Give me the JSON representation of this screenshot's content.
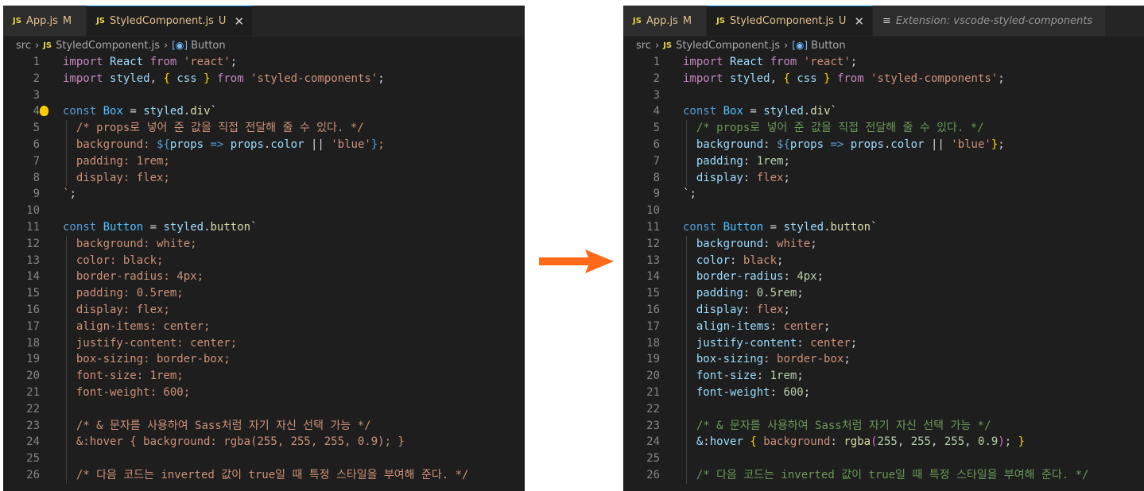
{
  "colors": {
    "editor_bg": "#1e1e1e",
    "tabbar_bg": "#252526",
    "arrow": "#ff6a1a",
    "js_badge": "#e8d44d",
    "modified": "#e2c08d"
  },
  "panes": [
    {
      "tabs": [
        {
          "badge": "JS",
          "name": "App.js",
          "status": "M",
          "active": false
        },
        {
          "badge": "JS",
          "name": "StyledComponent.js",
          "status": "U",
          "active": true,
          "close": "✕"
        }
      ],
      "breadcrumb": {
        "folder": "src",
        "file_badge": "JS",
        "file": "StyledComponent.js",
        "symbol_icon": "symbol-variable-icon",
        "symbol": "Button"
      },
      "highlighted": false
    },
    {
      "tabs": [
        {
          "badge": "JS",
          "name": "App.js",
          "status": "M",
          "active": false
        },
        {
          "badge": "JS",
          "name": "StyledComponent.js",
          "status": "U",
          "active": true,
          "close": "✕"
        },
        {
          "icon": "preview-icon",
          "name": "Extension: vscode-styled-components",
          "active": false
        }
      ],
      "breadcrumb": {
        "folder": "src",
        "file_badge": "JS",
        "file": "StyledComponent.js",
        "symbol_icon": "symbol-variable-icon",
        "symbol": "Button"
      },
      "highlighted": true
    }
  ],
  "code_lines": [
    {
      "n": "1",
      "text": "import React from 'react';"
    },
    {
      "n": "2",
      "text": "import styled, { css } from 'styled-components';"
    },
    {
      "n": "3",
      "text": ""
    },
    {
      "n": "4",
      "text": "const Box = styled.div`"
    },
    {
      "n": "5",
      "text": "  /* props로 넣어 준 값을 직접 전달해 줄 수 있다. */"
    },
    {
      "n": "6",
      "text": "  background: ${props => props.color || 'blue'};"
    },
    {
      "n": "7",
      "text": "  padding: 1rem;"
    },
    {
      "n": "8",
      "text": "  display: flex;"
    },
    {
      "n": "9",
      "text": "`;"
    },
    {
      "n": "10",
      "text": ""
    },
    {
      "n": "11",
      "text": "const Button = styled.button`"
    },
    {
      "n": "12",
      "text": "  background: white;"
    },
    {
      "n": "13",
      "text": "  color: black;"
    },
    {
      "n": "14",
      "text": "  border-radius: 4px;"
    },
    {
      "n": "15",
      "text": "  padding: 0.5rem;"
    },
    {
      "n": "16",
      "text": "  display: flex;"
    },
    {
      "n": "17",
      "text": "  align-items: center;"
    },
    {
      "n": "18",
      "text": "  justify-content: center;"
    },
    {
      "n": "19",
      "text": "  box-sizing: border-box;"
    },
    {
      "n": "20",
      "text": "  font-size: 1rem;"
    },
    {
      "n": "21",
      "text": "  font-weight: 600;"
    },
    {
      "n": "22",
      "text": ""
    },
    {
      "n": "23",
      "text": "  /* & 문자를 사용하여 Sass처럼 자기 자신 선택 가능 */"
    },
    {
      "n": "24",
      "text": "  &:hover { background: rgba(255, 255, 255, 0.9); }"
    },
    {
      "n": "25",
      "text": ""
    },
    {
      "n": "26",
      "text": "  /* 다음 코드는 inverted 값이 true일 때 특정 스타일을 부여해 준다. */"
    }
  ]
}
